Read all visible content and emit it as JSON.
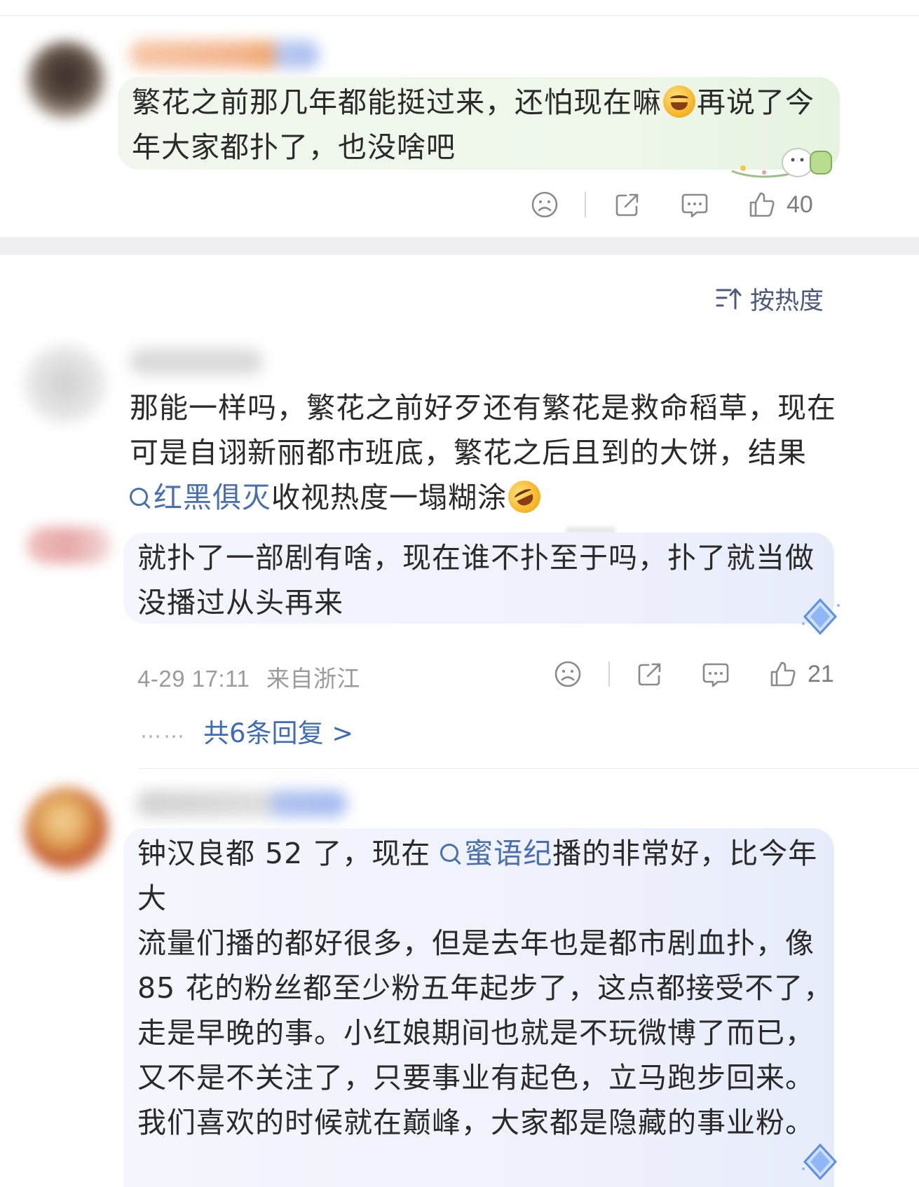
{
  "comment1": {
    "text": "繁花之前那几年都能挺过来，还怕现在嘛😂再说了今年大家都扑了，也没啥吧",
    "text_line1_a": "繁花之前那几年都能挺过来，还怕现在嘛",
    "text_line1_b": "再说了今",
    "text_line2": "年大家都扑了，也没啥吧",
    "like_count": "40"
  },
  "sort": {
    "label": "按热度"
  },
  "comment2": {
    "line1": "那能一样吗，繁花之前好歹还有繁花是救命稻草，现在",
    "line2": "可是自诩新丽都市班底，繁花之后且到的大饼，结果",
    "topic": "红黑俱灭",
    "line3_rest": "收视热度一塌糊涂",
    "reply_line1": "就扑了一部剧有啥，现在谁不扑至于吗，扑了就当做",
    "reply_line2": "没播过从头再来",
    "timestamp": "4-29 17:11",
    "location": "来自浙江",
    "like_count": "21",
    "dots": "……",
    "more_replies": "共6条回复 >"
  },
  "comment3": {
    "line1_a": "钟汉良都 52 了，现在",
    "topic": "蜜语纪",
    "line1_b": "播的非常好，比今年大",
    "line2": "流量们播的都好很多，但是去年也是都市剧血扑，像",
    "line3": "85 花的粉丝都至少粉五年起步了，这点都接受不了，",
    "line4": "走是早晚的事。小红娘期间也就是不玩微博了而已，",
    "line5": "又不是不关注了，只要事业有起色，立马跑步回来。",
    "line6": "我们喜欢的时候就在巅峰，大家都是隐藏的事业粉。"
  },
  "icons": {
    "dislike": "sad-face-icon",
    "share": "share-icon",
    "comment": "comment-icon",
    "like": "thumbs-up-icon",
    "sort": "sort-icon",
    "search": "search-icon"
  },
  "colors": {
    "link_blue": "#4a6fb0",
    "meta_gray": "#9b9b9b",
    "green_bubble": "#eef7ea",
    "blue_bubble": "#eef1fc"
  }
}
